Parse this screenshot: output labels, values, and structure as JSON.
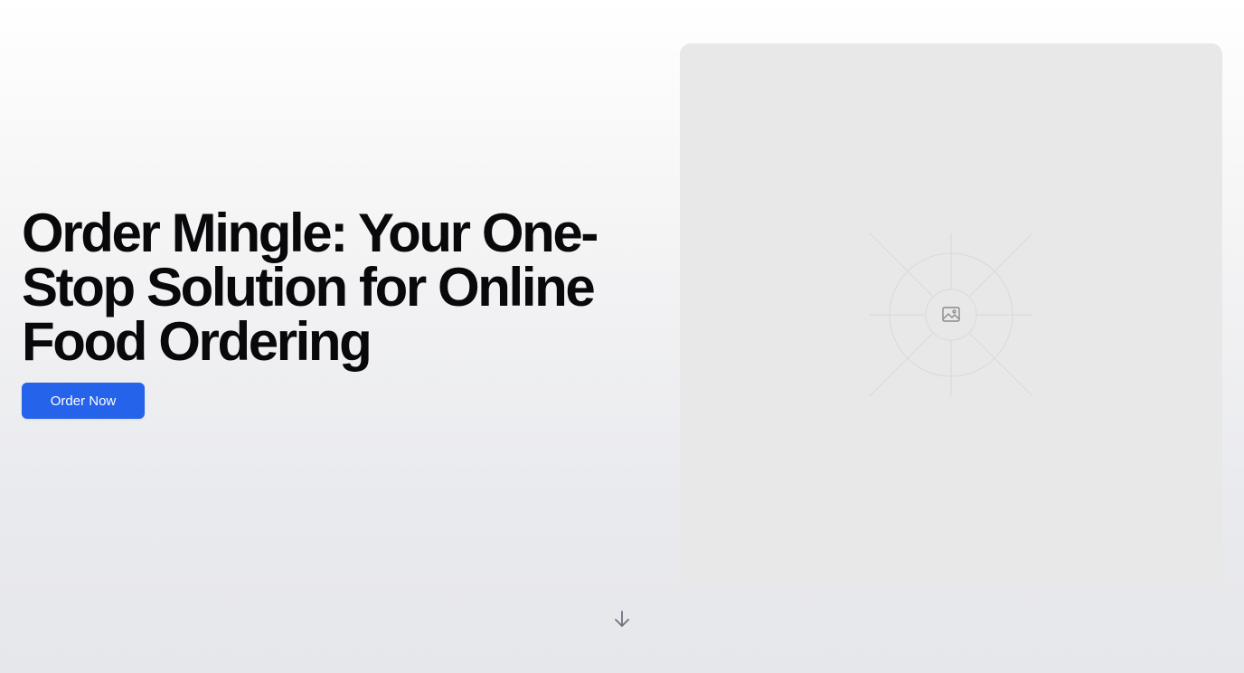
{
  "hero": {
    "title": "Order Mingle: Your One-Stop Solution for Online Food Ordering",
    "cta_label": "Order Now"
  },
  "media": {
    "icon": "image-icon"
  },
  "scroll": {
    "icon": "arrow-down-icon"
  },
  "colors": {
    "accent": "#2563eb",
    "title": "#09090b",
    "placeholder_bg": "#e8e8e9"
  }
}
